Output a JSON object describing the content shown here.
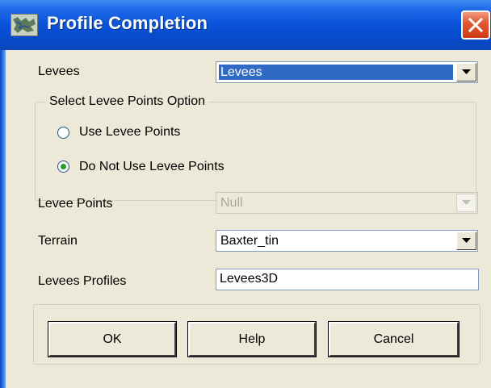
{
  "window": {
    "title": "Profile Completion",
    "icon": "map-icon",
    "close_icon": "close-icon"
  },
  "form": {
    "levees_label": "Levees",
    "levees_value": "Levees",
    "group_title": "Select Levee Points Option",
    "radio_use_label": "Use Levee Points",
    "radio_use_checked": false,
    "radio_not_use_label": "Do Not Use Levee Points",
    "radio_not_use_checked": true,
    "levee_points_label": "Levee Points",
    "levee_points_value": "Null",
    "levee_points_enabled": false,
    "terrain_label": "Terrain",
    "terrain_value": "Baxter_tin",
    "profiles_label": "Levees Profiles",
    "profiles_value": "Levees3D"
  },
  "buttons": {
    "ok": "OK",
    "help": "Help",
    "cancel": "Cancel"
  },
  "colors": {
    "titlebar": "#0a52d9",
    "selection": "#316ac5",
    "dialog_bg": "#ece9d8",
    "close_button": "#e25a34"
  }
}
